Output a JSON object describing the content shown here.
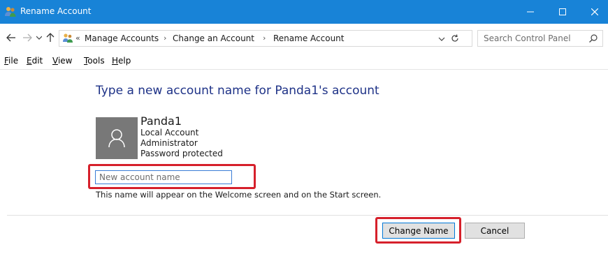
{
  "window": {
    "title": "Rename Account",
    "accent_color": "#1883d7",
    "controls": {
      "minimize": "—",
      "maximize": "☐",
      "close": "✕"
    }
  },
  "nav": {
    "back_icon": "back-arrow-icon",
    "forward_icon": "forward-arrow-icon",
    "recent_icon": "chevron-down-icon",
    "up_icon": "up-arrow-icon"
  },
  "address": {
    "overflow": "«",
    "crumbs": [
      "Manage Accounts",
      "Change an Account",
      "Rename Account"
    ],
    "separator": "›"
  },
  "search": {
    "placeholder": "Search Control Panel"
  },
  "menu": [
    {
      "label": "File",
      "accel": "F",
      "rest": "ile"
    },
    {
      "label": "Edit",
      "accel": "E",
      "rest": "dit"
    },
    {
      "label": "View",
      "accel": "V",
      "rest": "iew"
    },
    {
      "label": "Tools",
      "accel": "T",
      "rest": "ools"
    },
    {
      "label": "Help",
      "accel": "H",
      "rest": "elp"
    }
  ],
  "content": {
    "heading": "Type a new account name for Panda1's account",
    "user": {
      "name": "Panda1",
      "details": [
        "Local Account",
        "Administrator",
        "Password protected"
      ]
    },
    "input_placeholder": "New account name",
    "helper_text": "This name will appear on the Welcome screen and on the Start screen."
  },
  "buttons": {
    "change": "Change Name",
    "cancel": "Cancel"
  },
  "highlight_color": "#d6202b"
}
